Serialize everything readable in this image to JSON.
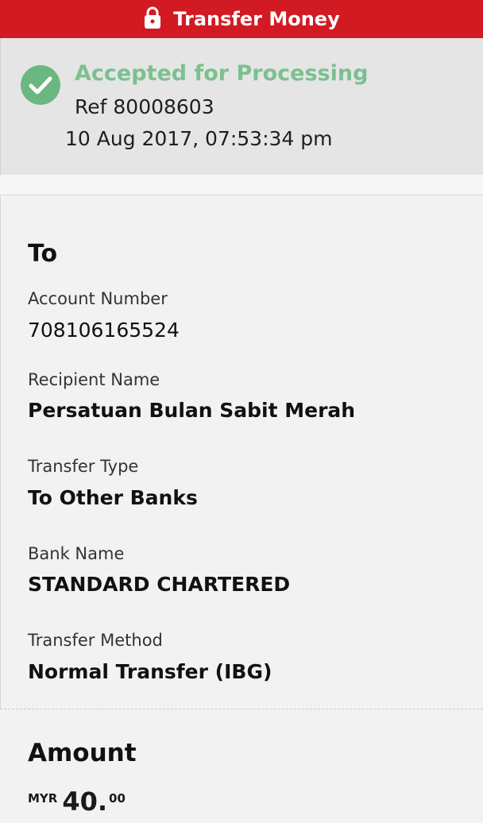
{
  "header": {
    "title": "Transfer Money",
    "icon": "lock-icon"
  },
  "status": {
    "title": "Accepted for Processing",
    "reference": "Ref 80008603",
    "timestamp": "10 Aug 2017, 07:53:34 pm",
    "accent_color": "#6ab77f"
  },
  "to": {
    "heading": "To",
    "fields": [
      {
        "label": "Account Number",
        "value": "708106165524"
      },
      {
        "label": "Recipient Name",
        "value": "Persatuan Bulan Sabit Merah"
      },
      {
        "label": "Transfer Type",
        "value": "To Other Banks"
      },
      {
        "label": "Bank Name",
        "value": "STANDARD CHARTERED"
      },
      {
        "label": "Transfer Method",
        "value": "Normal Transfer (IBG)"
      }
    ]
  },
  "amount": {
    "heading": "Amount",
    "currency": "MYR",
    "whole": "40.",
    "decimal": "00"
  },
  "colors": {
    "header_bg": "#d21a22",
    "status_bg": "#e5e5e5",
    "page_bg": "#f2f2f2"
  }
}
